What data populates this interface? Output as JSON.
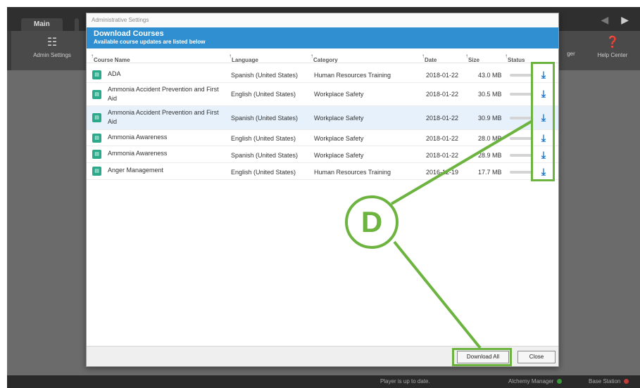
{
  "background": {
    "tabs": [
      "Main"
    ],
    "tools": [
      {
        "label": "Admin Settings",
        "icon": "sliders-icon"
      },
      {
        "label": "Help Center",
        "icon": "question-icon"
      }
    ],
    "partial_label": "ger",
    "status_bar": {
      "message": "Player is up to date.",
      "alchemy_manager": "Alchemy Manager",
      "base_station": "Base Station"
    }
  },
  "dialog": {
    "window_title": "Administrative Settings",
    "header_title": "Download Courses",
    "header_subtitle": "Available course updates are listed below",
    "columns": {
      "course_name": "Course Name",
      "language": "Language",
      "category": "Category",
      "date": "Date",
      "size": "Size",
      "status": "Status"
    },
    "rows": [
      {
        "name": "ADA",
        "language": "Spanish (United States)",
        "category": "Human Resources Training",
        "date": "2018-01-22",
        "size": "43.0 MB"
      },
      {
        "name": "Ammonia Accident Prevention and First Aid",
        "language": "English (United States)",
        "category": "Workplace Safety",
        "date": "2018-01-22",
        "size": "30.5 MB"
      },
      {
        "name": "Ammonia Accident Prevention and First Aid",
        "language": "Spanish (United States)",
        "category": "Workplace Safety",
        "date": "2018-01-22",
        "size": "30.9 MB"
      },
      {
        "name": "Ammonia Awareness",
        "language": "English (United States)",
        "category": "Workplace Safety",
        "date": "2018-01-22",
        "size": "28.0 MB"
      },
      {
        "name": "Ammonia Awareness",
        "language": "Spanish (United States)",
        "category": "Workplace Safety",
        "date": "2018-01-22",
        "size": "28.9 MB"
      },
      {
        "name": "Anger Management",
        "language": "English (United States)",
        "category": "Human Resources Training",
        "date": "2016-12-19",
        "size": "17.7 MB"
      }
    ],
    "download_all_label": "Download All",
    "close_label": "Close"
  },
  "callout": {
    "letter": "D"
  },
  "colors": {
    "header_blue": "#2f8fd0",
    "highlight_green": "#6db33f",
    "download_blue": "#1e78d2",
    "course_icon_teal": "#2aaa8a"
  }
}
